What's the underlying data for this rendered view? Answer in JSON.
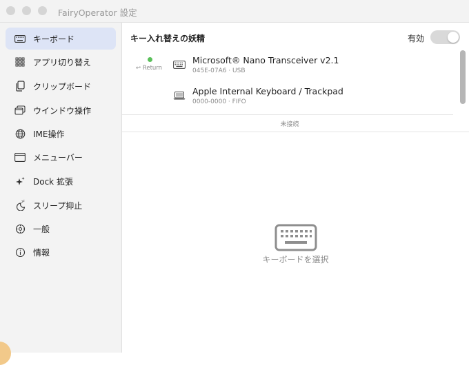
{
  "window": {
    "title": "FairyOperator 設定"
  },
  "sidebar": {
    "items": [
      {
        "label": "キーボード",
        "icon": "keyboard-icon",
        "active": true
      },
      {
        "label": "アプリ切り替え",
        "icon": "app-grid-icon"
      },
      {
        "label": "クリップボード",
        "icon": "clipboard-icon"
      },
      {
        "label": "ウインドウ操作",
        "icon": "window-stack-icon"
      },
      {
        "label": "IME操作",
        "icon": "globe-icon"
      },
      {
        "label": "メニューバー",
        "icon": "menubar-icon"
      },
      {
        "label": "Dock 拡張",
        "icon": "sparkle-icon"
      },
      {
        "label": "スリープ抑止",
        "icon": "moon-sleep-icon"
      },
      {
        "label": "一般",
        "icon": "gear-icon"
      },
      {
        "label": "情報",
        "icon": "info-icon"
      }
    ]
  },
  "main": {
    "section_title": "キー入れ替えの妖精",
    "enable_label": "有効",
    "enabled": false,
    "devices": [
      {
        "name": "Microsoft® Nano Transceiver v2.1",
        "meta": "045E-07A6 · USB",
        "status": "connected",
        "hint": "↩ Return",
        "icon": "keyboard-icon"
      },
      {
        "name": "Apple Internal Keyboard / Trackpad",
        "meta": "0000-0000 · FIFO",
        "icon": "laptop-icon"
      }
    ],
    "unconnected_label": "未接続",
    "empty_state_text": "キーボードを選択",
    "empty_state_icon": "keyboard-large-icon"
  },
  "colors": {
    "accent_active_bg": "#dde4f6",
    "status_green": "#5ac05a"
  }
}
